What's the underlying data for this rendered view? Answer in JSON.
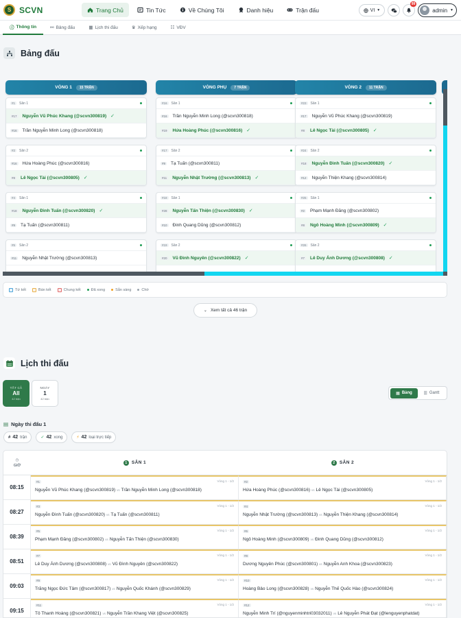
{
  "brand": {
    "name": "SCVN",
    "logo_mark": "S"
  },
  "nav": [
    {
      "label": "Trang Chủ",
      "icon": "home-icon",
      "active": true
    },
    {
      "label": "Tin Tức",
      "icon": "news-icon",
      "active": false
    },
    {
      "label": "Về Chúng Tôi",
      "icon": "info-icon",
      "active": false
    },
    {
      "label": "Danh hiệu",
      "icon": "award-icon",
      "active": false
    },
    {
      "label": "Trận đấu",
      "icon": "gamepad-icon",
      "active": false
    }
  ],
  "topbar": {
    "lang": "VI",
    "notif_count": "99",
    "user": "admin"
  },
  "subtabs": [
    {
      "label": "Thông tin",
      "icon": "info-circle-icon",
      "active": true
    },
    {
      "label": "Bảng đấu",
      "icon": "bracket-icon",
      "active": false
    },
    {
      "label": "Lịch thi đấu",
      "icon": "calendar-icon",
      "active": false
    },
    {
      "label": "Xếp hạng",
      "icon": "trophy-icon",
      "active": false
    },
    {
      "label": "VĐV",
      "icon": "users-icon",
      "active": false
    }
  ],
  "bracket": {
    "title": "Bảng đấu",
    "columns": [
      {
        "name": "VÒNG 1",
        "count": "15 TRẬN",
        "matches": [
          {
            "id": "#1",
            "court": "Sân 1",
            "p1": {
              "seed": "#17",
              "name": "Nguyễn Vũ Phúc Khang (@scvn300819)",
              "win": true
            },
            "p2": {
              "seed": "#16",
              "name": "Trần Nguyễn Minh Long (@scvn300818)",
              "win": false
            }
          },
          {
            "id": "#2",
            "court": "Sân 2",
            "p1": {
              "seed": "#16",
              "name": "Hứa Hoàng Phúc (@scvn300816)",
              "win": false
            },
            "p2": {
              "seed": "#8",
              "name": "Lê Ngọc Tài (@scvn300805)",
              "win": true
            }
          },
          {
            "id": "#4",
            "court": "Sân 1",
            "p1": {
              "seed": "#18",
              "name": "Nguyễn Đình Tuấn (@scvn300820)",
              "win": true
            },
            "p2": {
              "seed": "#9",
              "name": "Tạ Tuấn (@scvn300811)",
              "win": false
            }
          },
          {
            "id": "#5",
            "court": "Sân 2",
            "p1": {
              "seed": "#11",
              "name": "Nguyễn Nhật Trường (@scvn300813)",
              "win": false
            },
            "p2": {
              "seed": "",
              "name": "",
              "win": false
            }
          }
        ]
      },
      {
        "name": "VÒNG PHỤ",
        "count": "7 TRẬN",
        "matches": [
          {
            "id": "#16",
            "court": "Sân 1",
            "p1": {
              "seed": "#16",
              "name": "Trần Nguyễn Minh Long (@scvn300818)",
              "win": false
            },
            "p2": {
              "seed": "#19",
              "name": "Hứa Hoàng Phúc (@scvn300816)",
              "win": true
            }
          },
          {
            "id": "#17",
            "court": "Sân 2",
            "p1": {
              "seed": "#9",
              "name": "Tạ Tuấn (@scvn300811)",
              "win": false
            },
            "p2": {
              "seed": "#11",
              "name": "Nguyễn Nhật Trường (@scvn300813)",
              "win": true
            }
          },
          {
            "id": "#18",
            "court": "Sân 1",
            "p1": {
              "seed": "#28",
              "name": "Nguyễn Tấn Thiện (@scvn300830)",
              "win": true
            },
            "p2": {
              "seed": "#10",
              "name": "Đinh Quang Dũng (@scvn300812)",
              "win": false
            }
          },
          {
            "id": "#19",
            "court": "Sân 2",
            "p1": {
              "seed": "#20",
              "name": "Vũ Đình Nguyên (@scvn300822)",
              "win": true
            },
            "p2": {
              "seed": "",
              "name": "",
              "win": false
            }
          }
        ]
      },
      {
        "name": "VÒNG 2",
        "count": "11 TRẬN",
        "matches": [
          {
            "id": "#23",
            "court": "Sân 1",
            "p1": {
              "seed": "#17",
              "name": "Nguyễn Vũ Phúc Khang (@scvn300819)",
              "win": false
            },
            "p2": {
              "seed": "#8",
              "name": "Lê Ngọc Tài (@scvn300805)",
              "win": true
            }
          },
          {
            "id": "#24",
            "court": "Sân 2",
            "p1": {
              "seed": "#18",
              "name": "Nguyễn Đình Tuấn (@scvn300820)",
              "win": true
            },
            "p2": {
              "seed": "#12",
              "name": "Nguyễn Thiện Khang (@scvn300814)",
              "win": false
            }
          },
          {
            "id": "#25",
            "court": "Sân 1",
            "p1": {
              "seed": "#2",
              "name": "Phạm Mạnh Đăng (@scvn300802)",
              "win": false
            },
            "p2": {
              "seed": "#8",
              "name": "Ngô Hoàng Minh (@scvn300809)",
              "win": true
            }
          },
          {
            "id": "#26",
            "court": "Sân 2",
            "p1": {
              "seed": "#7",
              "name": "Lê Duy Ánh Dương (@scvn300808)",
              "win": true
            },
            "p2": {
              "seed": "",
              "name": "",
              "win": false
            }
          }
        ]
      }
    ],
    "legend": [
      {
        "label": "Tứ kết",
        "kind": "square",
        "color": "#4aa3d8"
      },
      {
        "label": "Bán kết",
        "kind": "square",
        "color": "#e8b04a"
      },
      {
        "label": "Chung kết",
        "kind": "square",
        "color": "#e06a6a"
      },
      {
        "label": "Đã xong",
        "kind": "dot",
        "color": "#1f9d55"
      },
      {
        "label": "Sẵn sàng",
        "kind": "dot",
        "color": "#f0a020"
      },
      {
        "label": "Chờ",
        "kind": "dot",
        "color": "#9aa4ad"
      }
    ],
    "more_label": "Xem tất cả 46 trận"
  },
  "schedule": {
    "title": "Lịch thi đấu",
    "days": [
      {
        "top": "TẤT CẢ",
        "mid": "All",
        "bot": "42 trận",
        "active": true
      },
      {
        "top": "NGÀY",
        "mid": "1",
        "bot": "42 trận",
        "active": false
      }
    ],
    "views": [
      {
        "label": "Bảng",
        "icon": "table-icon",
        "active": true
      },
      {
        "label": "Gantt",
        "icon": "gantt-icon",
        "active": false
      }
    ],
    "day_label": "Ngày thi đấu 1",
    "chips": [
      {
        "icon": "#",
        "value": "42",
        "label": "trận"
      },
      {
        "icon": "✓",
        "value": "42",
        "label": "xong"
      },
      {
        "icon": "⚡",
        "value": "42",
        "label": "loại trực tiếp"
      }
    ],
    "time_header": "GIỜ",
    "courts": [
      {
        "num": "1",
        "label": "SÂN 1"
      },
      {
        "num": "2",
        "label": "SÂN 2"
      }
    ],
    "vs": "vs",
    "rows": [
      {
        "time": "08:15",
        "m": [
          {
            "id": "#1",
            "round": "Vòng 1 - 1/2",
            "a": "Nguyễn Vũ Phúc Khang (@scvn300819)",
            "b": "Trần Nguyễn Minh Long (@scvn300818)"
          },
          {
            "id": "#2",
            "round": "Vòng 1 - 1/2",
            "a": "Hứa Hoàng Phúc (@scvn300816)",
            "b": "Lê Ngọc Tài (@scvn300805)"
          }
        ]
      },
      {
        "time": "08:27",
        "m": [
          {
            "id": "#3",
            "round": "Vòng 1 - 1/2",
            "a": "Nguyễn Đình Tuấn (@scvn300820)",
            "b": "Tạ Tuấn (@scvn300811)"
          },
          {
            "id": "#4",
            "round": "Vòng 1 - 1/2",
            "a": "Nguyễn Nhật Trường (@scvn300813)",
            "b": "Nguyễn Thiện Khang (@scvn300814)"
          }
        ]
      },
      {
        "time": "08:39",
        "m": [
          {
            "id": "#5",
            "round": "Vòng 1 - 1/2",
            "a": "Phạm Mạnh Đăng (@scvn300802)",
            "b": "Nguyễn Tấn Thiện (@scvn300830)"
          },
          {
            "id": "#6",
            "round": "Vòng 1 - 1/2",
            "a": "Ngô Hoàng Minh (@scvn300809)",
            "b": "Đinh Quang Dũng (@scvn300812)"
          }
        ]
      },
      {
        "time": "08:51",
        "m": [
          {
            "id": "#7",
            "round": "Vòng 1 - 1/2",
            "a": "Lê Duy Ánh Dương (@scvn300808)",
            "b": "Vũ Đình Nguyên (@scvn300822)"
          },
          {
            "id": "#8",
            "round": "Vòng 1 - 1/2",
            "a": "Dương Nguyên Phúc (@scvn300801)",
            "b": "Nguyễn Anh Khoa (@scvn300823)"
          }
        ]
      },
      {
        "time": "09:03",
        "m": [
          {
            "id": "#9",
            "round": "Vòng 1 - 1/2",
            "a": "Trăng Ngọc Đức Tâm (@scvn300817)",
            "b": "Nguyễn Quốc Khánh (@scvn300829)"
          },
          {
            "id": "#10",
            "round": "Vòng 1 - 1/2",
            "a": "Hoàng Bảo Long (@scvn300828)",
            "b": "Nguyễn Thế Quốc Hào (@scvn300824)"
          }
        ]
      },
      {
        "time": "09:15",
        "m": [
          {
            "id": "#11",
            "round": "Vòng 1 - 1/2",
            "a": "Tô Thanh Hoàng (@scvn300821)",
            "b": "Nguyễn Trần Khang Việt (@scvn300825)"
          },
          {
            "id": "#12",
            "round": "Vòng 1 - 1/2",
            "a": "Nguyễn Minh Trí (@nguyenminhtri03032011)",
            "b": "Lê Nguyễn Phát Đạt (@lenguyenphatdat)"
          }
        ]
      }
    ]
  }
}
